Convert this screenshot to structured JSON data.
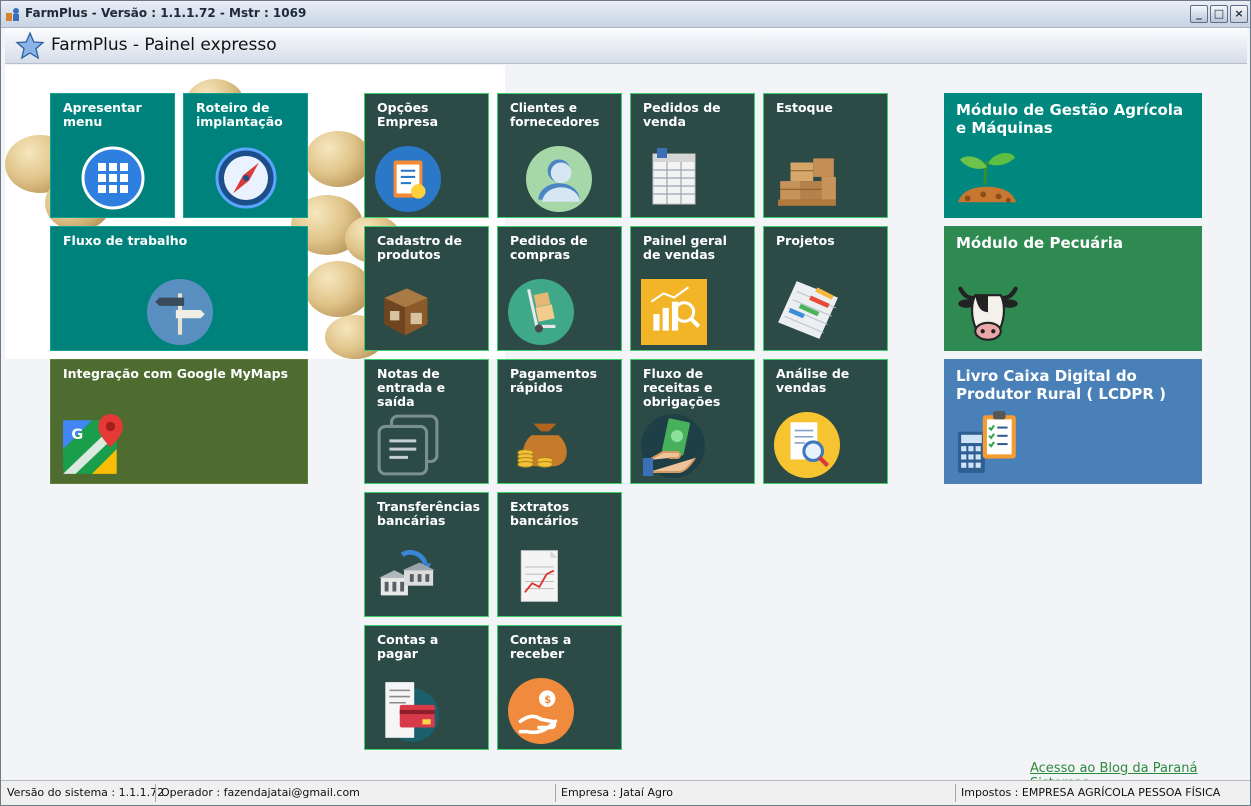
{
  "window": {
    "title": "FarmPlus -  Versão : 1.1.1.72 - Mstr : 1069"
  },
  "header": {
    "title": "FarmPlus - Painel expresso"
  },
  "tiles": {
    "apresentar_menu": "Apresentar menu",
    "roteiro": "Roteiro de implantação",
    "fluxo_trabalho": "Fluxo de trabalho",
    "google_mymaps": "Integração com Google MyMaps",
    "opcoes_empresa": "Opções Empresa",
    "clientes": "Clientes e fornecedores",
    "pedidos_venda": "Pedidos de venda",
    "estoque": "Estoque",
    "cadastro_produtos": "Cadastro de produtos",
    "pedidos_compras": "Pedidos de compras",
    "painel_vendas": "Painel geral de vendas",
    "projetos": "Projetos",
    "notas": "Notas de entrada e saída",
    "pagamentos": "Pagamentos rápidos",
    "fluxo_receitas": "Fluxo de receitas e obrigações",
    "analise_vendas": "Análise de vendas",
    "transferencias": "Transferências bancárias",
    "extratos": "Extratos bancários",
    "contas_pagar": "Contas a pagar",
    "contas_receber": "Contas a receber"
  },
  "modules": {
    "gestao_agricola": "Módulo de Gestão Agrícola e Máquinas",
    "pecuaria": "Módulo de Pecuária",
    "lcdpr": "Livro Caixa Digital do Produtor Rural ( LCDPR )"
  },
  "links": {
    "blog": "Acesso ao Blog da Paraná Sistemas"
  },
  "status": {
    "versao": "Versão do sistema : 1.1.1.72",
    "operador": "Operador : fazendajatai@gmail.com",
    "empresa": "Empresa : Jataí Agro",
    "impostos": "Impostos : EMPRESA AGRÍCOLA PESSOA FÍSICA"
  },
  "colors": {
    "tile_dark": "#2c4a46",
    "tile_teal": "#00827c",
    "tile_olive": "#4e6b30",
    "module_agricola": "#00877e",
    "module_pecuaria": "#2f8a52",
    "module_lcdpr": "#4a80b8",
    "link": "#2d8a3c"
  }
}
